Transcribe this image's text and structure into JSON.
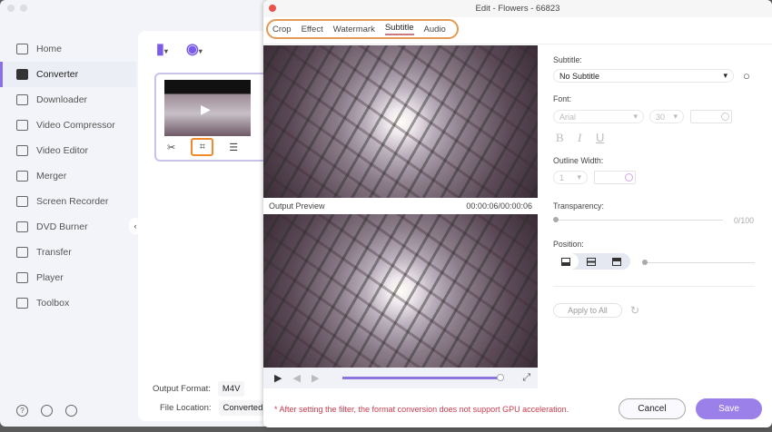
{
  "sidebar": {
    "items": [
      {
        "label": "Home",
        "icon": "home-icon"
      },
      {
        "label": "Converter",
        "icon": "converter-icon",
        "active": true
      },
      {
        "label": "Downloader",
        "icon": "downloader-icon"
      },
      {
        "label": "Video Compressor",
        "icon": "compressor-icon"
      },
      {
        "label": "Video Editor",
        "icon": "editor-icon"
      },
      {
        "label": "Merger",
        "icon": "merger-icon"
      },
      {
        "label": "Screen Recorder",
        "icon": "recorder-icon"
      },
      {
        "label": "DVD Burner",
        "icon": "dvd-icon"
      },
      {
        "label": "Transfer",
        "icon": "transfer-icon"
      },
      {
        "label": "Player",
        "icon": "player-icon"
      },
      {
        "label": "Toolbox",
        "icon": "toolbox-icon"
      }
    ]
  },
  "main": {
    "output_format_label": "Output Format:",
    "output_format": "M4V",
    "file_location_label": "File Location:",
    "file_location": "Converted"
  },
  "dialog": {
    "title": "Edit - Flowers - 66823",
    "tabs": [
      "Crop",
      "Effect",
      "Watermark",
      "Subtitle",
      "Audio"
    ],
    "active_tab": "Subtitle",
    "preview_label": "Output Preview",
    "timecode": "00:00:06/00:00:06",
    "progress": 1.0,
    "note": "* After setting the filter, the format conversion does not support GPU acceleration.",
    "cancel": "Cancel",
    "save": "Save"
  },
  "subtitle": {
    "subtitle_label": "Subtitle:",
    "subtitle_value": "No Subtitle",
    "font_label": "Font:",
    "font": "Arial",
    "size": "30",
    "bold": "B",
    "italic": "I",
    "underline": "U",
    "outline_label": "Outline Width:",
    "outline": "1",
    "transparency_label": "Transparency:",
    "transparency": "0/100",
    "position_label": "Position:",
    "apply": "Apply to All"
  },
  "colors": {
    "accent": "#9c80ea",
    "highlight": "#e39a55",
    "warning": "#c83c4e"
  }
}
